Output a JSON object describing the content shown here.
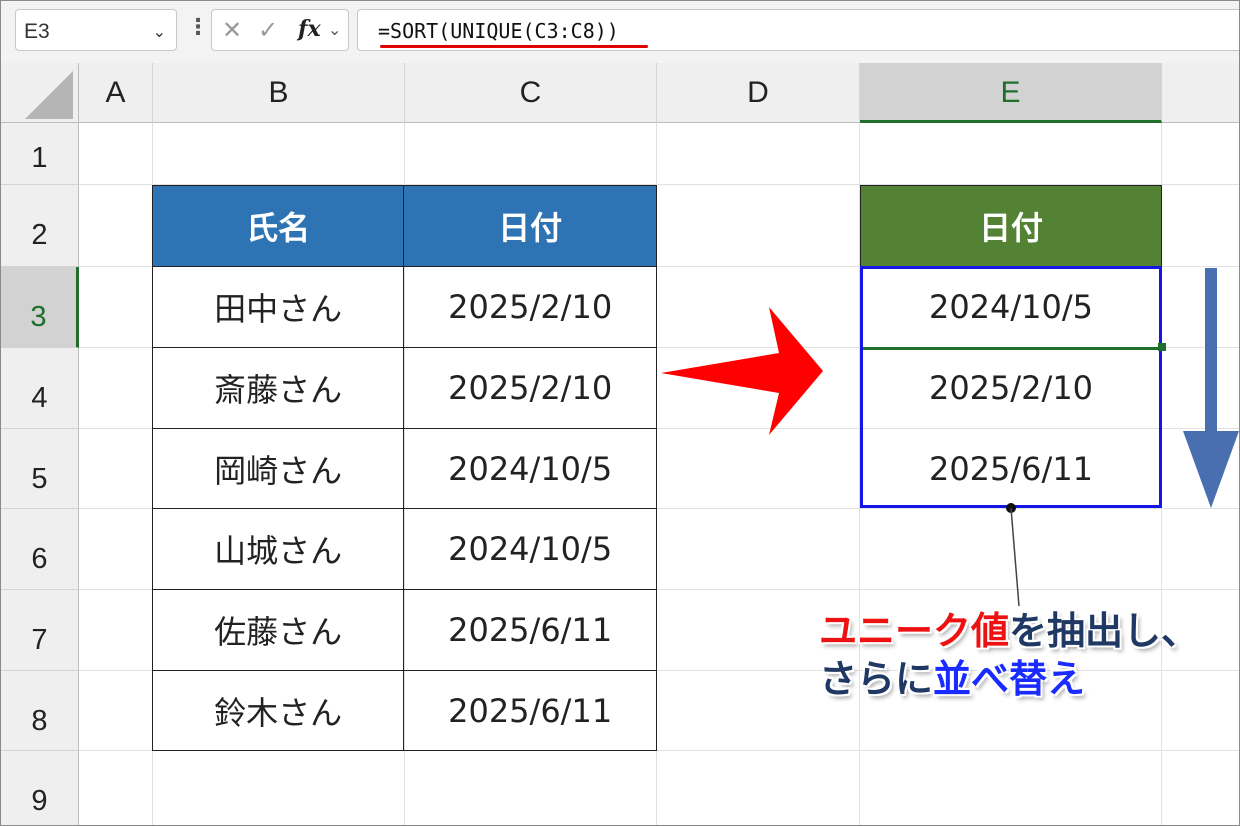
{
  "formula_bar": {
    "name_box": "E3",
    "fx_label": "fx",
    "formula": "=SORT(UNIQUE(C3:C8))"
  },
  "columns": [
    "A",
    "B",
    "C",
    "D",
    "E"
  ],
  "rows": [
    "1",
    "2",
    "3",
    "4",
    "5",
    "6",
    "7",
    "8",
    "9"
  ],
  "source_table": {
    "headers": [
      "氏名",
      "日付"
    ],
    "rows": [
      [
        "田中さん",
        "2025/2/10"
      ],
      [
        "斎藤さん",
        "2025/2/10"
      ],
      [
        "岡崎さん",
        "2024/10/5"
      ],
      [
        "山城さん",
        "2024/10/5"
      ],
      [
        "佐藤さん",
        "2025/6/11"
      ],
      [
        "鈴木さん",
        "2025/6/11"
      ]
    ]
  },
  "result_table": {
    "header": "日付",
    "values": [
      "2024/10/5",
      "2025/2/10",
      "2025/6/11"
    ]
  },
  "annotation": {
    "line1_red": "ユニーク値",
    "line1_rest": "を抽出し、",
    "line2_start": "さらに",
    "line2_blue": "並べ替え"
  },
  "colors": {
    "source_header": "#2e74b5",
    "result_header": "#548235",
    "result_border": "#1515e6",
    "arrow_red": "#ff0000",
    "arrow_blue": "#4a6fb0"
  }
}
